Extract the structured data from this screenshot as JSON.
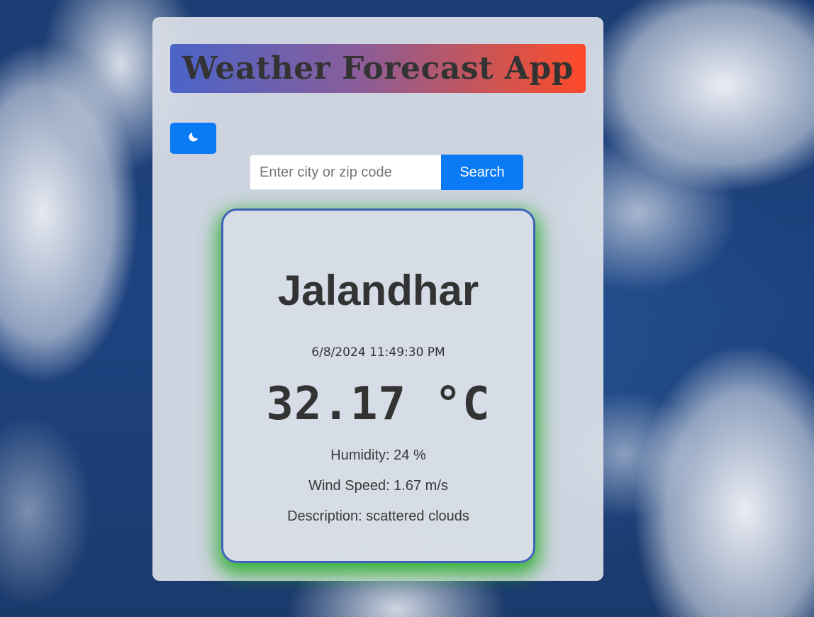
{
  "app": {
    "title": "Weather Forecast App"
  },
  "theme_toggle": {
    "icon": "moon-icon"
  },
  "search": {
    "placeholder": "Enter city or zip code",
    "value": "",
    "button_label": "Search"
  },
  "weather": {
    "city": "Jalandhar",
    "datetime": "6/8/2024 11:49:30 PM",
    "temperature": "32.17 °C",
    "humidity": "Humidity: 24 %",
    "wind_speed": "Wind Speed: 1.67 m/s",
    "description": "Description: scattered clouds"
  },
  "colors": {
    "accent": "#0a7bf5",
    "title_gradient_start": "#4a64c8",
    "title_gradient_end": "#ff4a2a",
    "card_border": "#3d63b8",
    "card_glow": "#1eaa1e"
  }
}
